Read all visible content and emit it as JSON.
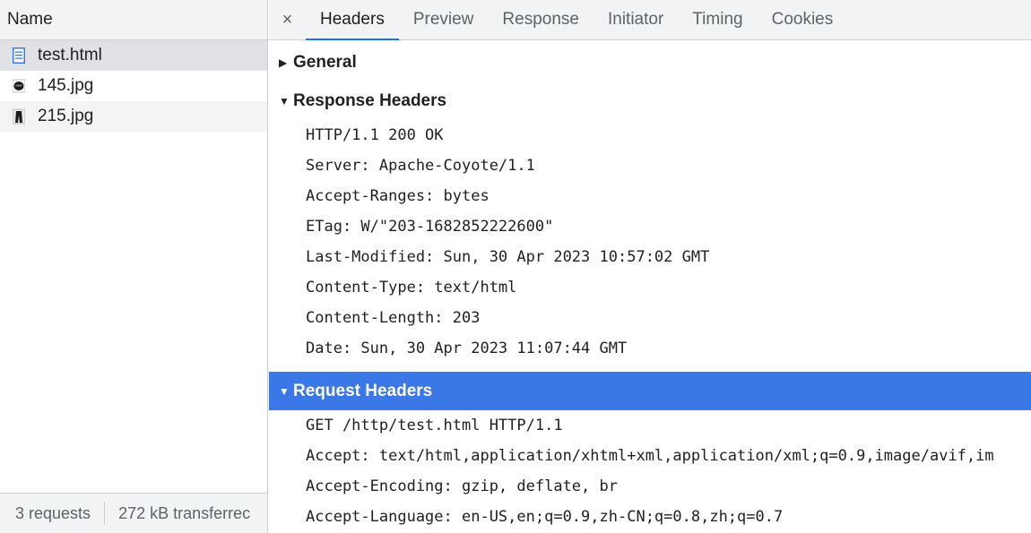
{
  "left": {
    "column_header": "Name",
    "requests": [
      {
        "name": "test.html",
        "icon": "document-icon"
      },
      {
        "name": "145.jpg",
        "icon": "image-thumbnail-icon"
      },
      {
        "name": "215.jpg",
        "icon": "image-thumbnail-icon"
      }
    ],
    "footer": {
      "requests": "3 requests",
      "transferred": "272 kB transferrec"
    }
  },
  "tabs": {
    "close": "×",
    "items": [
      "Headers",
      "Preview",
      "Response",
      "Initiator",
      "Timing",
      "Cookies"
    ],
    "active": "Headers"
  },
  "sections": {
    "general": {
      "title": "General",
      "expanded": false
    },
    "response": {
      "title": "Response Headers",
      "expanded": true,
      "lines": [
        "HTTP/1.1 200 OK",
        "Server: Apache-Coyote/1.1",
        "Accept-Ranges: bytes",
        "ETag: W/\"203-1682852222600\"",
        "Last-Modified: Sun, 30 Apr 2023 10:57:02 GMT",
        "Content-Type: text/html",
        "Content-Length: 203",
        "Date: Sun, 30 Apr 2023 11:07:44 GMT"
      ]
    },
    "request": {
      "title": "Request Headers",
      "expanded": true,
      "lines": [
        "GET /http/test.html HTTP/1.1",
        "Accept: text/html,application/xhtml+xml,application/xml;q=0.9,image/avif,im",
        "Accept-Encoding: gzip, deflate, br",
        "Accept-Language: en-US,en;q=0.9,zh-CN;q=0.8,zh;q=0.7"
      ]
    }
  },
  "colors": {
    "selection_blue": "#3b78e7",
    "tab_underline": "#1a73e8",
    "panel_bg": "#f1f3f4"
  }
}
